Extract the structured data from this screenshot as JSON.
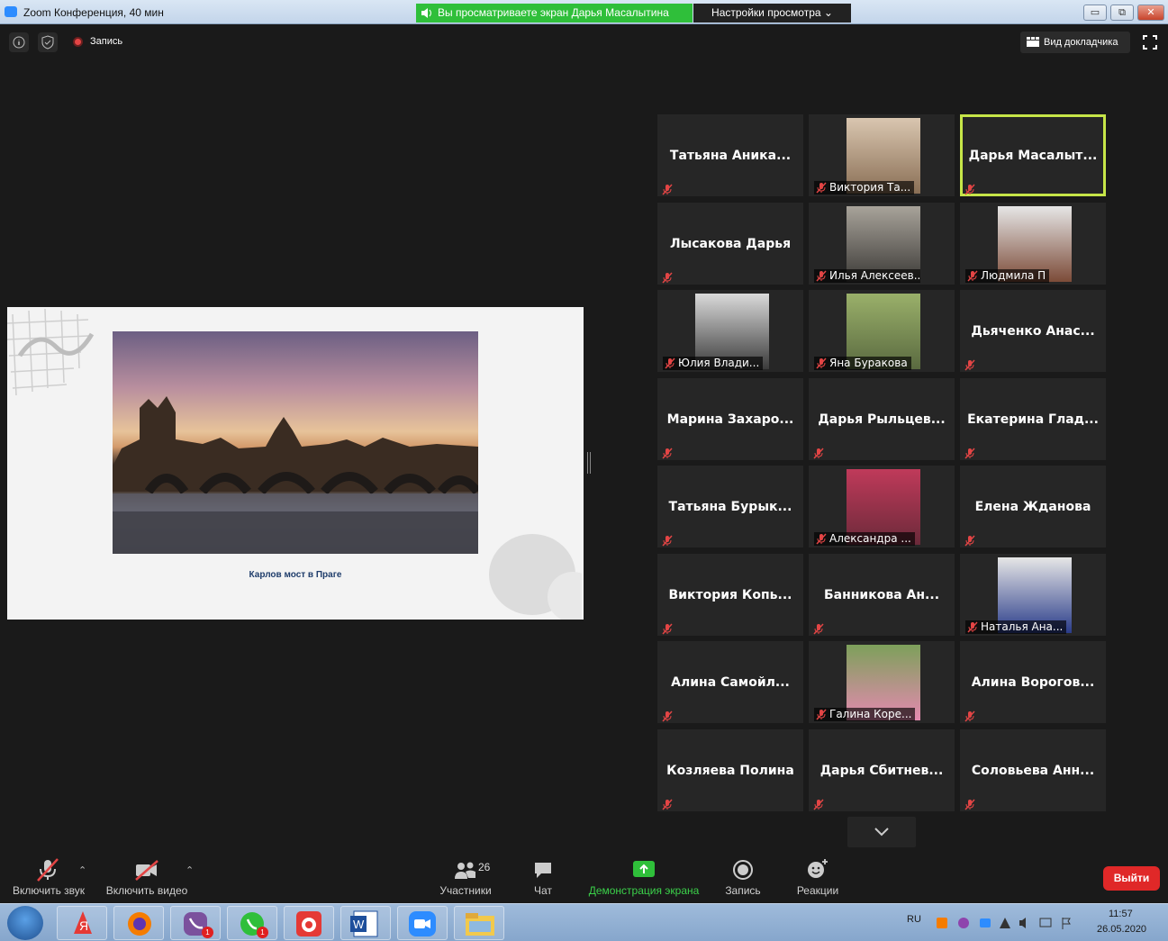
{
  "window": {
    "title": "Zoom Конференция, 40 мин",
    "share_banner": "Вы просматриваете экран Дарья Масалытина",
    "view_settings": "Настройки просмотра ⌄",
    "minimize": "▭",
    "restore": "⧉",
    "close": "✕"
  },
  "topbar": {
    "record_label": "Запись",
    "speaker_view_label": "Вид докладчика"
  },
  "shared_screen": {
    "caption": "Карлов мост в Праге"
  },
  "participants": [
    {
      "name": "Татьяна  Аника...",
      "type": "name"
    },
    {
      "name": "Виктория Та...",
      "type": "video"
    },
    {
      "name": "Дарья  Масалыт...",
      "type": "name",
      "active": true
    },
    {
      "name": "Лысакова Дарья",
      "type": "name"
    },
    {
      "name": "Илья Алексеев...",
      "type": "video"
    },
    {
      "name": "Людмила П",
      "type": "video"
    },
    {
      "name": "Юлия Влади...",
      "type": "video"
    },
    {
      "name": "Яна Буракова",
      "type": "video"
    },
    {
      "name": "Дьяченко  Анас...",
      "type": "name"
    },
    {
      "name": "Марина  Захаро...",
      "type": "name"
    },
    {
      "name": "Дарья  Рыльцев...",
      "type": "name"
    },
    {
      "name": "Екатерина  Глад...",
      "type": "name"
    },
    {
      "name": "Татьяна  Бурык...",
      "type": "name"
    },
    {
      "name": "Александра ...",
      "type": "video"
    },
    {
      "name": "Елена Жданова",
      "type": "name"
    },
    {
      "name": "Виктория  Копь...",
      "type": "name"
    },
    {
      "name": "Банникова  Ан...",
      "type": "name"
    },
    {
      "name": "Наталья Ана...",
      "type": "video"
    },
    {
      "name": "Алина  Самойл...",
      "type": "name"
    },
    {
      "name": "Галина Коре...",
      "type": "video"
    },
    {
      "name": "Алина  Ворогов...",
      "type": "name"
    },
    {
      "name": "Козляева Полина",
      "type": "name"
    },
    {
      "name": "Дарья  Сбитнев...",
      "type": "name"
    },
    {
      "name": "Соловьева  Анн...",
      "type": "name"
    }
  ],
  "toolbar": {
    "audio_label": "Включить звук",
    "video_label": "Включить видео",
    "participants_label": "Участники",
    "participants_count": "26",
    "chat_label": "Чат",
    "share_label": "Демонстрация экрана",
    "record_label": "Запись",
    "reactions_label": "Реакции",
    "leave_label": "Выйти"
  },
  "taskbar": {
    "language": "RU",
    "time": "11:57",
    "date": "26.05.2020",
    "viber_badge": "1",
    "whatsapp_badge": "1"
  },
  "colors": {
    "accent_green": "#2fbf3a",
    "active_speaker": "#c6e548",
    "leave_red": "#e02828",
    "muted_red": "#e34545"
  }
}
